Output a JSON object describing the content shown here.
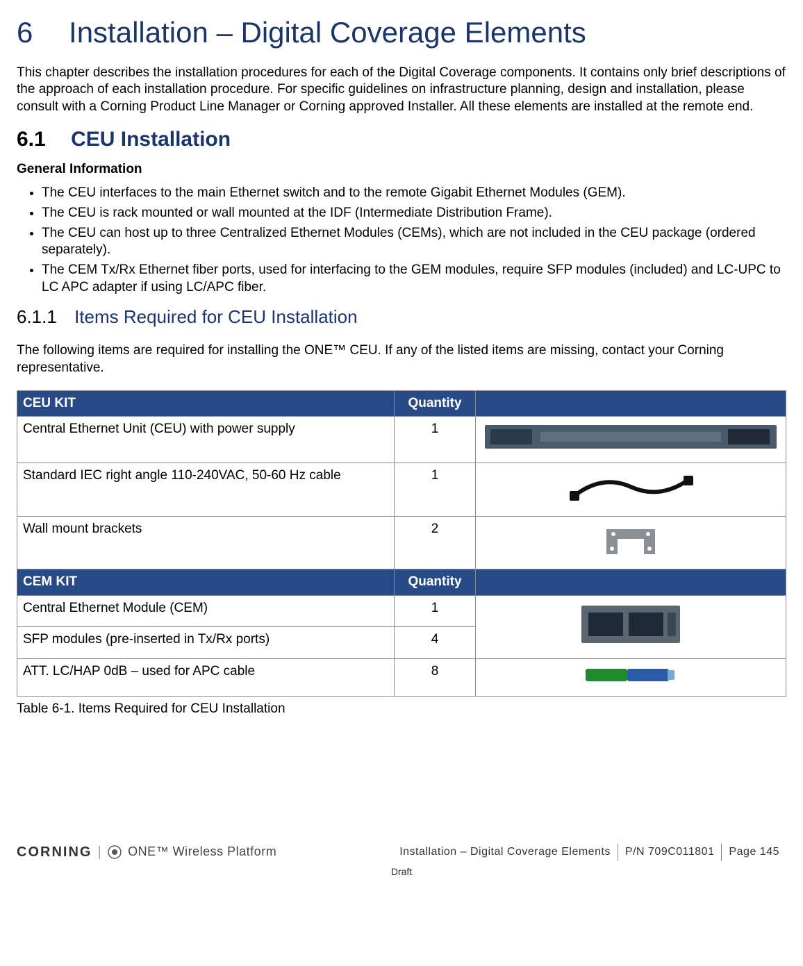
{
  "chapter": {
    "number": "6",
    "title": "Installation – Digital Coverage Elements"
  },
  "intro": "This chapter describes the installation procedures for each of the Digital Coverage components. It contains only brief descriptions of the approach of each installation procedure.   For specific guidelines on infrastructure planning, design and installation, please consult with a Corning Product Line Manager or Corning approved Installer. All these elements are installed at the remote end.",
  "section_6_1": {
    "number": "6.1",
    "title": "CEU Installation",
    "subhead": "General Information",
    "bullets": [
      "The CEU interfaces to the main Ethernet switch and to the remote Gigabit Ethernet Modules (GEM).",
      "The CEU is rack mounted or wall mounted at the IDF (Intermediate Distribution Frame).",
      "The CEU can host up to three Centralized Ethernet Modules (CEMs), which are not included in the CEU package (ordered separately).",
      "The CEM Tx/Rx Ethernet fiber ports, used for interfacing to the GEM modules, require SFP modules (included) and LC-UPC to LC APC adapter if using LC/APC fiber."
    ]
  },
  "section_6_1_1": {
    "number": "6.1.1",
    "title": "Items Required for CEU Installation",
    "lead": "The following items are required for installing the ONE™ CEU. If any of the listed items are missing, contact your Corning representative."
  },
  "table": {
    "header1": {
      "c1": "CEU KIT",
      "c2": "Quantity"
    },
    "rows1": [
      {
        "item": "Central Ethernet Unit (CEU) with power supply",
        "qty": "1"
      },
      {
        "item": "Standard IEC right angle 110-240VAC, 50-60 Hz cable",
        "qty": "1"
      },
      {
        "item": "Wall mount brackets",
        "qty": "2"
      }
    ],
    "header2": {
      "c1": "CEM KIT",
      "c2": "Quantity"
    },
    "rows2": [
      {
        "item": "Central Ethernet Module (CEM)",
        "qty": "1"
      },
      {
        "item": "SFP modules (pre-inserted in Tx/Rx ports)",
        "qty": "4"
      },
      {
        "item": "ATT. LC/HAP 0dB – used for APC cable",
        "qty": "8"
      }
    ],
    "caption": "Table 6-1. Items Required for CEU Installation"
  },
  "footer": {
    "brand": "CORNING",
    "platform": "ONE™ Wireless Platform",
    "doc_title": "Installation – Digital Coverage Elements",
    "pn": "P/N 709C011801",
    "page": "Page 145",
    "draft": "Draft"
  }
}
